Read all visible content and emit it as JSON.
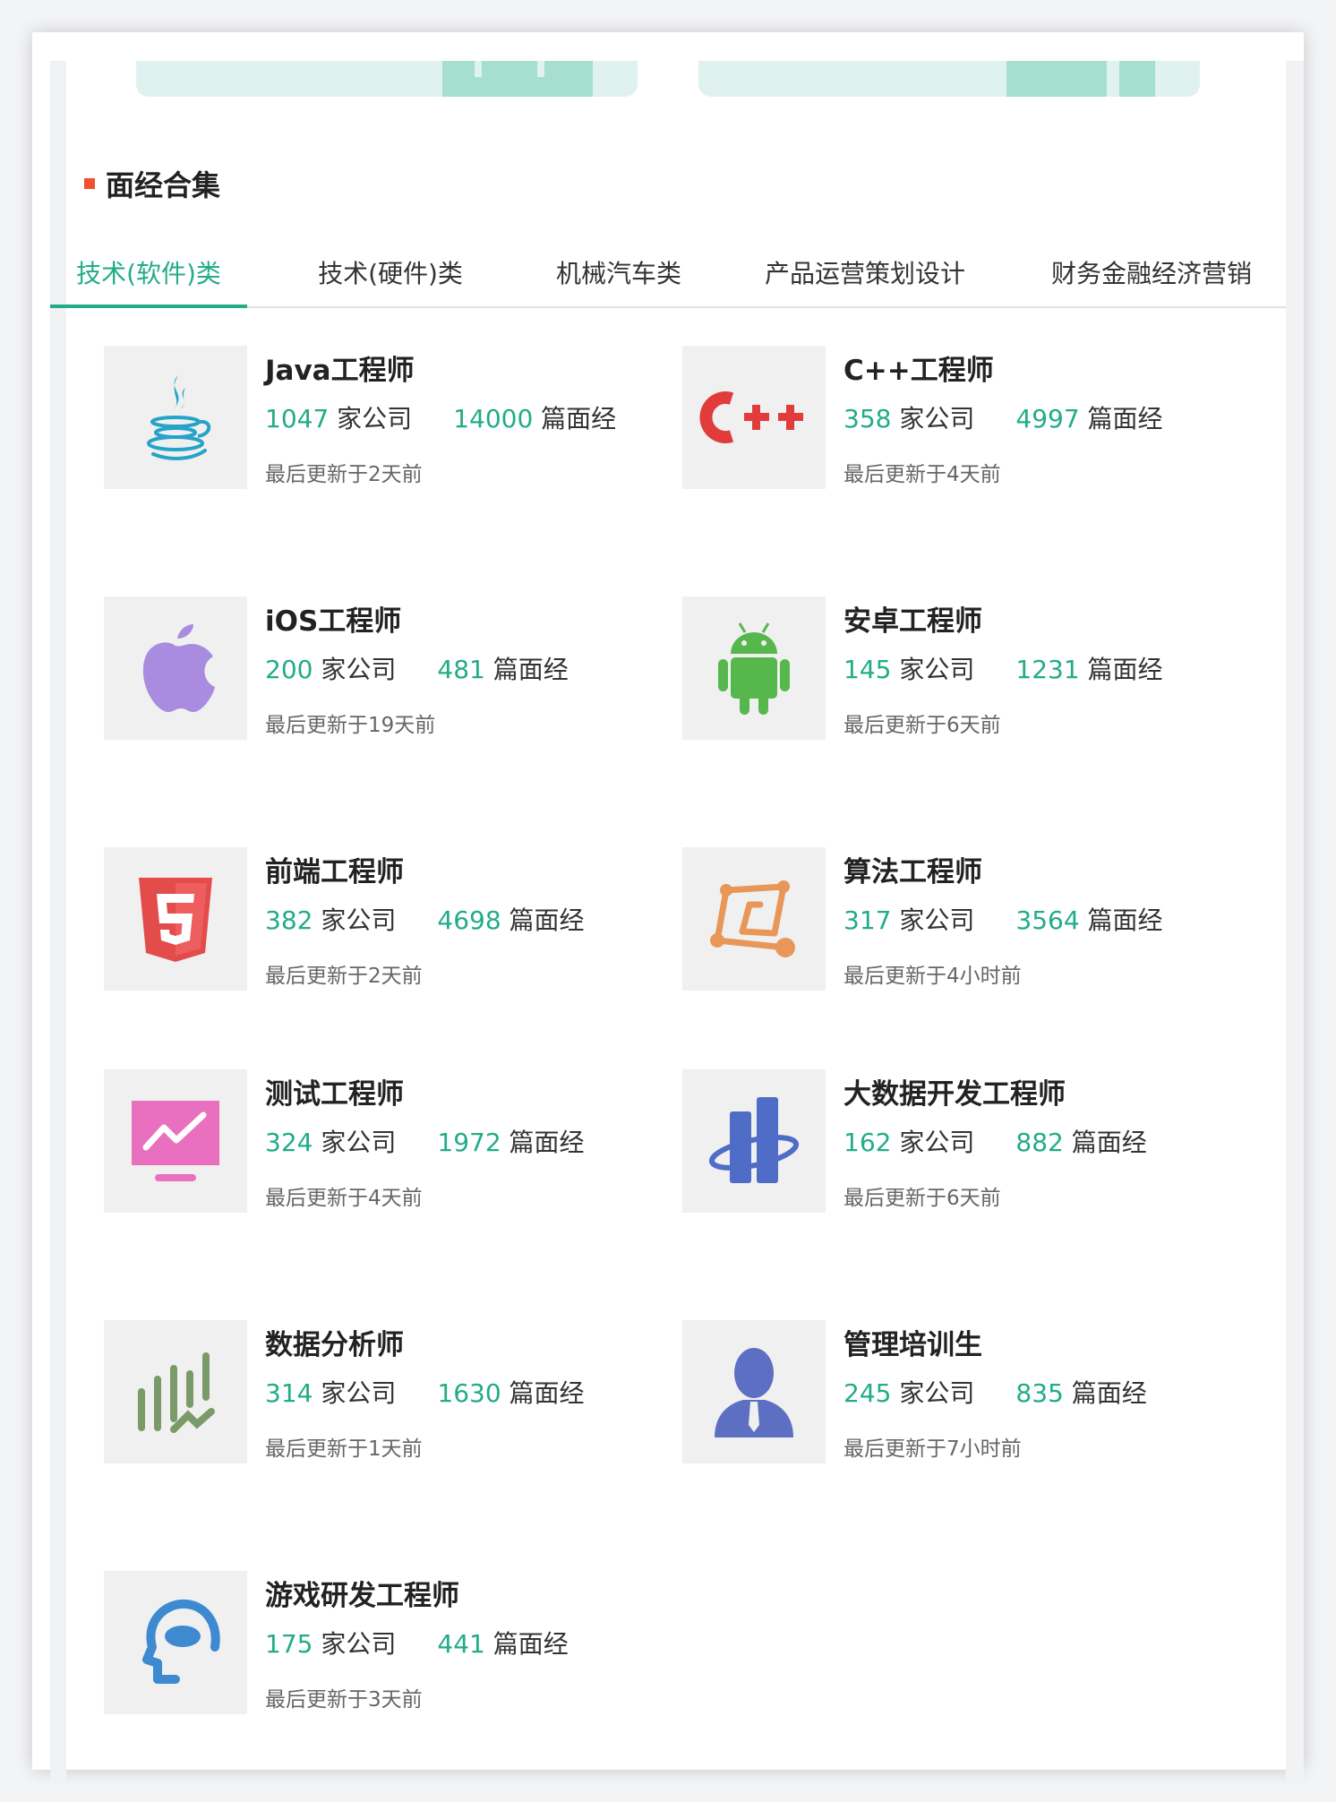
{
  "section": {
    "title": "面经合集"
  },
  "tabs": [
    {
      "label": "技术(软件)类",
      "active": true
    },
    {
      "label": "技术(硬件)类",
      "active": false
    },
    {
      "label": "机械汽车类",
      "active": false
    },
    {
      "label": "产品运营策划设计",
      "active": false
    },
    {
      "label": "财务金融经济营销",
      "active": false
    }
  ],
  "labels": {
    "companies_suffix": "家公司",
    "reviews_suffix": "篇面经"
  },
  "cards": [
    {
      "title": "Java工程师",
      "companies": "1047",
      "reviews": "14000",
      "updated": "最后更新于2天前",
      "icon": "java-icon"
    },
    {
      "title": "C++工程师",
      "companies": "358",
      "reviews": "4997",
      "updated": "最后更新于4天前",
      "icon": "cpp-icon"
    },
    {
      "title": "iOS工程师",
      "companies": "200",
      "reviews": "481",
      "updated": "最后更新于19天前",
      "icon": "apple-icon"
    },
    {
      "title": "安卓工程师",
      "companies": "145",
      "reviews": "1231",
      "updated": "最后更新于6天前",
      "icon": "android-icon"
    },
    {
      "title": "前端工程师",
      "companies": "382",
      "reviews": "4698",
      "updated": "最后更新于2天前",
      "icon": "html5-icon"
    },
    {
      "title": "算法工程师",
      "companies": "317",
      "reviews": "3564",
      "updated": "最后更新于4小时前",
      "icon": "algorithm-graph-icon"
    },
    {
      "title": "测试工程师",
      "companies": "324",
      "reviews": "1972",
      "updated": "最后更新于4天前",
      "icon": "monitor-chart-icon"
    },
    {
      "title": "大数据开发工程师",
      "companies": "162",
      "reviews": "882",
      "updated": "最后更新于6天前",
      "icon": "big-data-icon"
    },
    {
      "title": "数据分析师",
      "companies": "314",
      "reviews": "1630",
      "updated": "最后更新于1天前",
      "icon": "bar-analysis-icon"
    },
    {
      "title": "管理培训生",
      "companies": "245",
      "reviews": "835",
      "updated": "最后更新于7小时前",
      "icon": "manager-person-icon"
    },
    {
      "title": "游戏研发工程师",
      "companies": "175",
      "reviews": "441",
      "updated": "最后更新于3天前",
      "icon": "game-head-icon"
    }
  ],
  "colors": {
    "accent": "#22ac87",
    "bullet": "#f25032",
    "icon_bg": "#f0f0f0"
  }
}
